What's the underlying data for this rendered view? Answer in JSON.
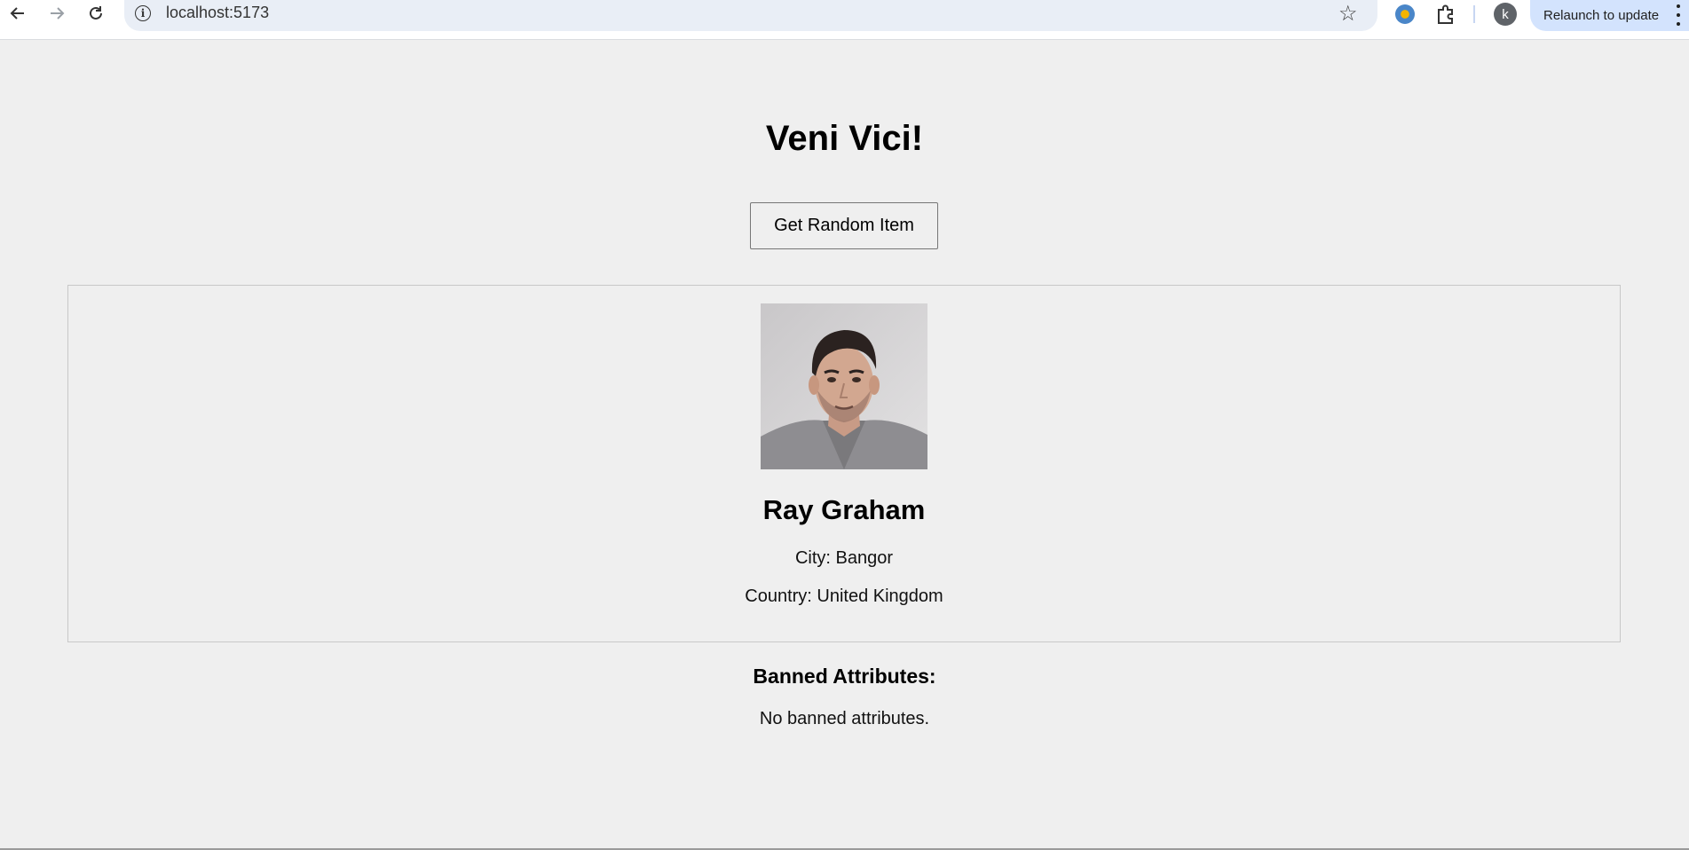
{
  "browser": {
    "url": "localhost:5173",
    "relaunch_label": "Relaunch to update",
    "profile_initial": "k"
  },
  "app": {
    "title": "Veni Vici!",
    "button_label": "Get Random Item"
  },
  "item": {
    "name": "Ray Graham",
    "city": "City: Bangor",
    "country": "Country: United Kingdom",
    "photo_alt": "Ray Graham"
  },
  "banned": {
    "heading": "Banned Attributes:",
    "empty_text": "No banned attributes."
  }
}
